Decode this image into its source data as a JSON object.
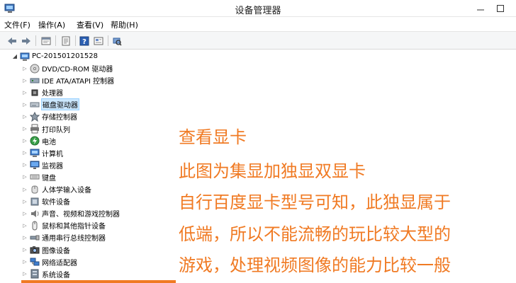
{
  "window": {
    "title": "设备管理器"
  },
  "menu": [
    "文件(F)",
    "操作(A)",
    "查看(V)",
    "帮助(H)"
  ],
  "toolbar": [
    "back-icon",
    "forward-icon",
    "properties-icon",
    "view-icon",
    "help-icon",
    "device-view-icon",
    "scan-hardware-icon"
  ],
  "tree": {
    "root": "PC-201501201528",
    "items": [
      {
        "label": "DVD/CD-ROM 驱动器",
        "icon": "dvd-icon"
      },
      {
        "label": "IDE ATA/ATAPI 控制器",
        "icon": "ide-controller-icon"
      },
      {
        "label": "处理器",
        "icon": "processor-icon"
      },
      {
        "label": "磁盘驱动器",
        "icon": "disk-drive-icon"
      },
      {
        "label": "存储控制器",
        "icon": "storage-controller-icon"
      },
      {
        "label": "打印队列",
        "icon": "printer-icon"
      },
      {
        "label": "电池",
        "icon": "battery-icon"
      },
      {
        "label": "计算机",
        "icon": "computer-icon"
      },
      {
        "label": "监视器",
        "icon": "monitor-icon"
      },
      {
        "label": "键盘",
        "icon": "keyboard-icon"
      },
      {
        "label": "人体学输入设备",
        "icon": "hid-icon"
      },
      {
        "label": "软件设备",
        "icon": "software-device-icon"
      },
      {
        "label": "声音、视频和游戏控制器",
        "icon": "sound-icon"
      },
      {
        "label": "鼠标和其他指针设备",
        "icon": "mouse-icon"
      },
      {
        "label": "通用串行总线控制器",
        "icon": "usb-icon"
      },
      {
        "label": "图像设备",
        "icon": "imaging-icon"
      },
      {
        "label": "网络适配器",
        "icon": "network-icon"
      },
      {
        "label": "系统设备",
        "icon": "system-device-icon"
      }
    ]
  },
  "annotation": {
    "lines": [
      "查看显卡",
      "此图为集显加独显双显卡",
      "自行百度显卡型号可知，此独显属于",
      "低端，所以不能流畅的玩比较大型的",
      "游戏，处理视频图像的能力比较一般"
    ],
    "color": "#f07a23"
  }
}
